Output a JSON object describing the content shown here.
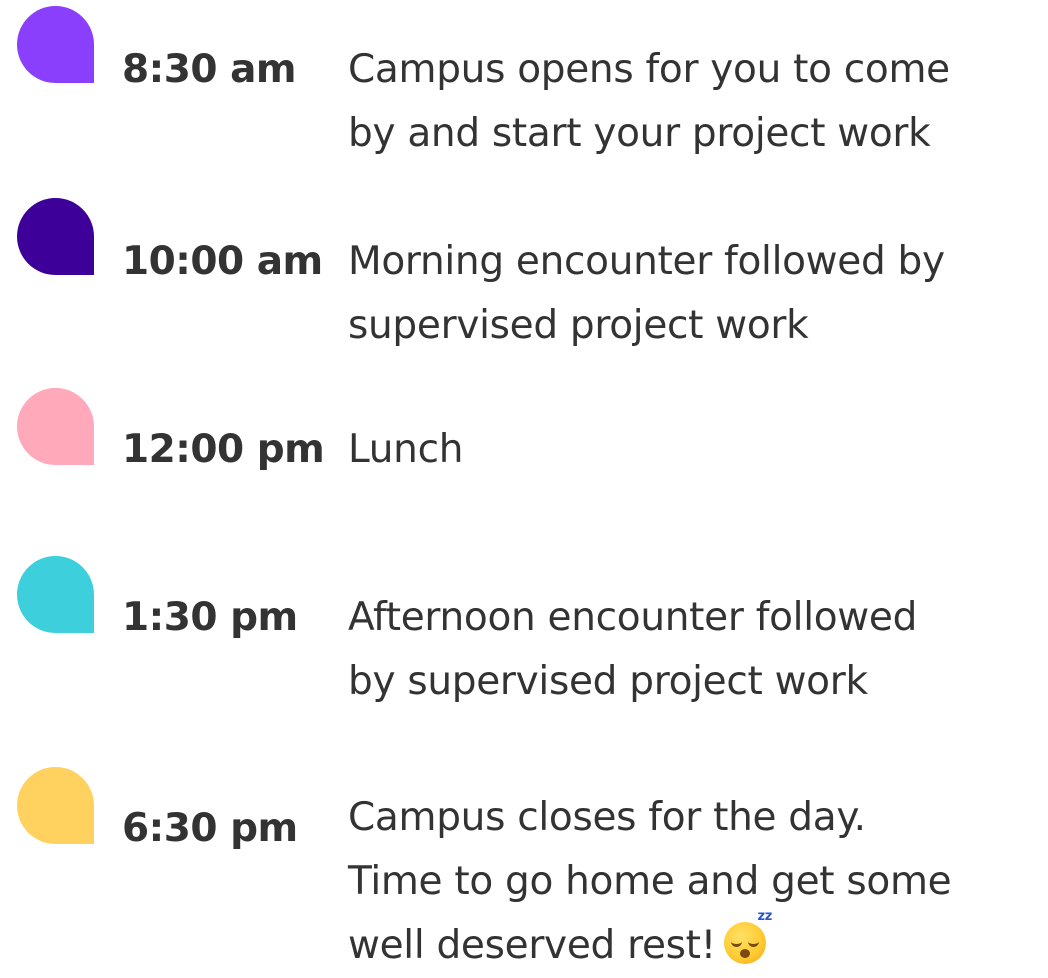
{
  "schedule": [
    {
      "time": "8:30 am",
      "marker_color": "#8a3ffc",
      "lines": [
        "Campus opens for you to come",
        "by and start your project work"
      ]
    },
    {
      "time": "10:00 am",
      "marker_color": "#3d0099",
      "lines": [
        "Morning encounter followed by",
        "supervised project work"
      ]
    },
    {
      "time": "12:00 pm",
      "marker_color": "#ffa9bb",
      "lines": [
        "Lunch"
      ]
    },
    {
      "time": "1:30 pm",
      "marker_color": "#3dcfdc",
      "lines": [
        "Afternoon encounter followed",
        "by supervised project work"
      ]
    },
    {
      "time": "6:30 pm",
      "marker_color": "#ffd15e",
      "lines": [
        "Campus closes for the day.",
        "Time to go home and get some",
        "well deserved rest!"
      ],
      "emoji": "sleeping-face-icon"
    }
  ]
}
